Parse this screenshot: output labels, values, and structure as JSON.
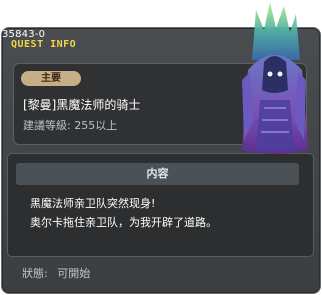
{
  "header": {
    "quest_id": "35843-0",
    "title": "QUEST INFO"
  },
  "summary": {
    "badge": "主要",
    "quest_name": "[黎曼]黑魔法师的骑士",
    "level_label": "建議等級:",
    "level_value": "255以上"
  },
  "content": {
    "header": "内容",
    "lines": [
      "黑魔法师亲卫队突然现身!",
      "奥尔卡拖住亲卫队，为我开辟了道路。"
    ]
  },
  "status": {
    "label": "狀態:",
    "value": "可開始"
  },
  "icons": {
    "quest_image": "dark-armored-knight-statue"
  }
}
